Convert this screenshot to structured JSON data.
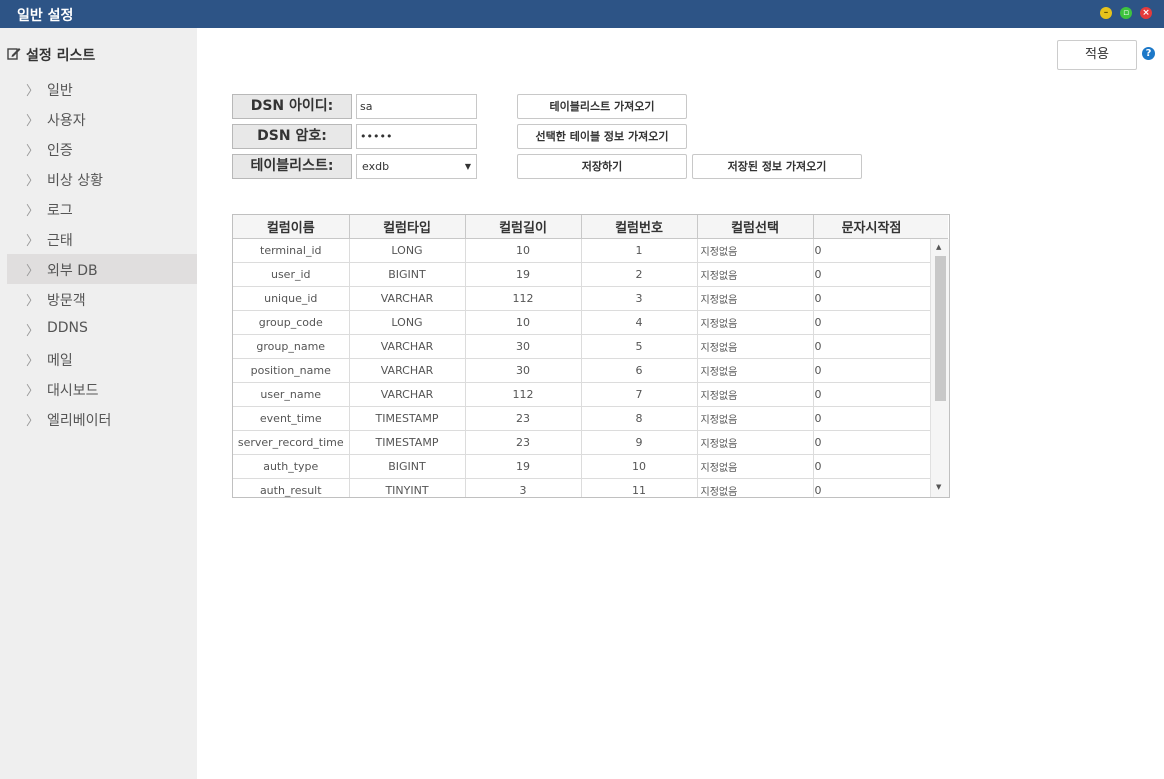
{
  "window": {
    "title": "일반 설정",
    "controls": [
      "minimize",
      "maximize",
      "close"
    ],
    "colors": {
      "titlebar": "#2d5486"
    }
  },
  "sidebar": {
    "header": "설정 리스트",
    "header_icon": "edit-icon",
    "items": [
      {
        "label": "일반",
        "active": false
      },
      {
        "label": "사용자",
        "active": false
      },
      {
        "label": "인증",
        "active": false
      },
      {
        "label": "비상 상황",
        "active": false
      },
      {
        "label": "로그",
        "active": false
      },
      {
        "label": "근태",
        "active": false
      },
      {
        "label": "외부 DB",
        "active": true
      },
      {
        "label": "방문객",
        "active": false
      },
      {
        "label": "DDNS",
        "active": false
      },
      {
        "label": "메일",
        "active": false
      },
      {
        "label": "대시보드",
        "active": false
      },
      {
        "label": "엘리베이터",
        "active": false
      }
    ]
  },
  "toolbar": {
    "apply_label": "적용",
    "help_icon": "help-icon"
  },
  "form": {
    "dsn_id_label": "DSN 아이디:",
    "dsn_id_value": "sa",
    "dsn_pw_label": "DSN 암호:",
    "dsn_pw_value": "•••••",
    "table_list_label": "테이블리스트:",
    "table_list_value": "exdb"
  },
  "actions": {
    "fetch_tables": "테이블리스트 가져오기",
    "fetch_selected_info": "선택한 테이블 정보 가져오기",
    "save": "저장하기",
    "load_saved": "저장된 정보 가져오기"
  },
  "grid": {
    "columns": [
      "컬럼이름",
      "컬럼타입",
      "컬럼길이",
      "컬럼번호",
      "컬럼선택",
      "문자시작점"
    ],
    "rows": [
      [
        "terminal_id",
        "LONG",
        "10",
        "1",
        "지정없음",
        "0"
      ],
      [
        "user_id",
        "BIGINT",
        "19",
        "2",
        "지정없음",
        "0"
      ],
      [
        "unique_id",
        "VARCHAR",
        "112",
        "3",
        "지정없음",
        "0"
      ],
      [
        "group_code",
        "LONG",
        "10",
        "4",
        "지정없음",
        "0"
      ],
      [
        "group_name",
        "VARCHAR",
        "30",
        "5",
        "지정없음",
        "0"
      ],
      [
        "position_name",
        "VARCHAR",
        "30",
        "6",
        "지정없음",
        "0"
      ],
      [
        "user_name",
        "VARCHAR",
        "112",
        "7",
        "지정없음",
        "0"
      ],
      [
        "event_time",
        "TIMESTAMP",
        "23",
        "8",
        "지정없음",
        "0"
      ],
      [
        "server_record_time",
        "TIMESTAMP",
        "23",
        "9",
        "지정없음",
        "0"
      ],
      [
        "auth_type",
        "BIGINT",
        "19",
        "10",
        "지정없음",
        "0"
      ],
      [
        "auth_result",
        "TINYINT",
        "3",
        "11",
        "지정없음",
        "0"
      ]
    ]
  }
}
